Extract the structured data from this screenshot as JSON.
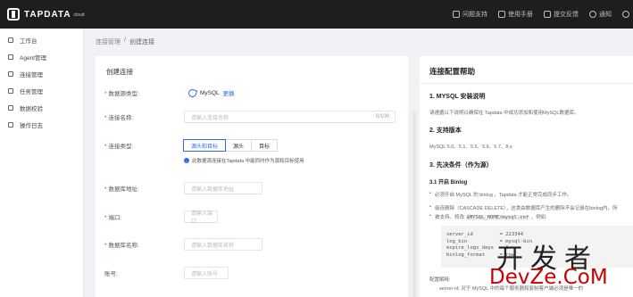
{
  "brand": {
    "name": "TAPDATA",
    "sup": "cloud"
  },
  "topbar": {
    "actions": [
      {
        "icon": "question-icon",
        "label": "问题支持"
      },
      {
        "icon": "paper-plane-icon",
        "label": "使用手册"
      },
      {
        "icon": "feedback-icon",
        "label": "提交反馈"
      },
      {
        "icon": "bell-icon",
        "label": "通知"
      }
    ]
  },
  "sidebar": {
    "items": [
      {
        "label": "工作台"
      },
      {
        "label": "Agent管理"
      },
      {
        "label": "连接管理"
      },
      {
        "label": "任务管理"
      },
      {
        "label": "数据校验"
      },
      {
        "label": "操作日志"
      }
    ]
  },
  "breadcrumb": {
    "parent": "连接管理",
    "sep": "/",
    "current": "创建连接"
  },
  "form": {
    "title": "创建连接",
    "db_type": {
      "label": "数据源类型:",
      "value": "MySQL",
      "change": "更换"
    },
    "conn_name": {
      "label": "连接名称:",
      "placeholder": "请输入连接名称",
      "counter": "0/100"
    },
    "conn_type": {
      "label": "连接类型:",
      "options": [
        "源头和目标",
        "源头",
        "目标"
      ],
      "selected": 0,
      "note": "此数据源连接在Tapdata 中能同时作为源和目标使用"
    },
    "host": {
      "label": "数据库地址:",
      "placeholder": "请输入数据库地址"
    },
    "port": {
      "label": "端口:",
      "placeholder": "请输入端口"
    },
    "dbname": {
      "label": "数据库名称:",
      "placeholder": "请输入数据库名称"
    },
    "account": {
      "label": "账号:",
      "placeholder": "请输入账号"
    }
  },
  "help": {
    "title": "连接配置帮助",
    "s1": "1. MYSQL 安装说明",
    "s1_text": "请遵循以下说明以确保在 Tapdata 中成功添加和使用MySQL数据库。",
    "s2": "2. 支持版本",
    "s2_text": "MySQL 5.0、5.1、5.5、5.6、5.7、8.x",
    "s3": "3. 先决条件（作为源）",
    "s31": "3.1 开启 Binlog",
    "b1": "必须开启 MySQL 的 binlog ，Tapdata 才能正常完成同步工作。",
    "b2": "级连删除（CASCADE DELETE），这类由数据库产生的删除不会记录在binlog内，所",
    "b2_cont_pre": "被支持。修改",
    "b2_code": "$MYSQL_HOME/mysql.cnf",
    "b2_cont_post": "，例如:",
    "code": [
      "server_id         = 223344",
      "log_bin           = mysql-bin",
      "expire_logs_days  = 1",
      "binlog_format     = row"
    ],
    "cfg_title": "配置解释:",
    "cfg_text": "server-id: 对于 MySQL 中的每个服务器和复制客户端必须是唯一的"
  },
  "watermark": {
    "top": "开发者",
    "bottom": "DevZe.CoM"
  }
}
